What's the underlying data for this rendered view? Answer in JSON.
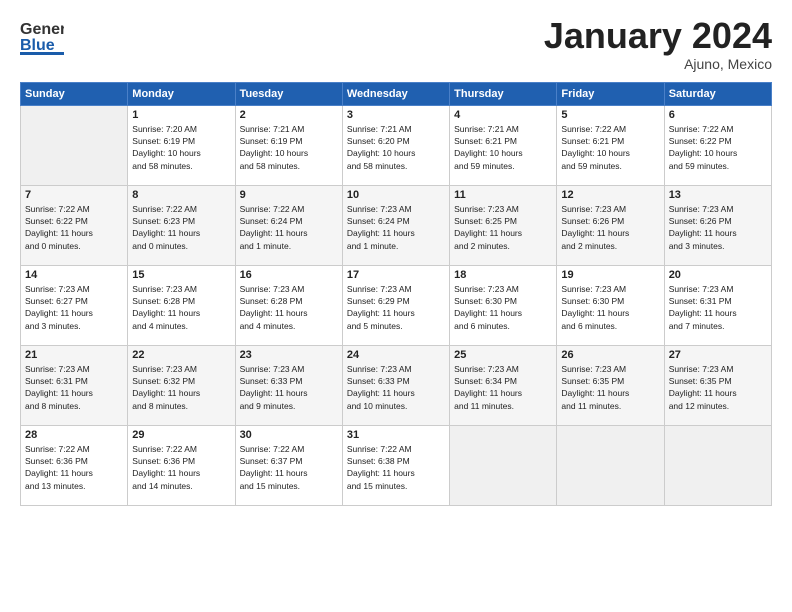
{
  "header": {
    "logo_general": "General",
    "logo_blue": "Blue",
    "month": "January 2024",
    "location": "Ajuno, Mexico"
  },
  "weekdays": [
    "Sunday",
    "Monday",
    "Tuesday",
    "Wednesday",
    "Thursday",
    "Friday",
    "Saturday"
  ],
  "weeks": [
    [
      {
        "day": "",
        "info": ""
      },
      {
        "day": "1",
        "info": "Sunrise: 7:20 AM\nSunset: 6:19 PM\nDaylight: 10 hours\nand 58 minutes."
      },
      {
        "day": "2",
        "info": "Sunrise: 7:21 AM\nSunset: 6:19 PM\nDaylight: 10 hours\nand 58 minutes."
      },
      {
        "day": "3",
        "info": "Sunrise: 7:21 AM\nSunset: 6:20 PM\nDaylight: 10 hours\nand 58 minutes."
      },
      {
        "day": "4",
        "info": "Sunrise: 7:21 AM\nSunset: 6:21 PM\nDaylight: 10 hours\nand 59 minutes."
      },
      {
        "day": "5",
        "info": "Sunrise: 7:22 AM\nSunset: 6:21 PM\nDaylight: 10 hours\nand 59 minutes."
      },
      {
        "day": "6",
        "info": "Sunrise: 7:22 AM\nSunset: 6:22 PM\nDaylight: 10 hours\nand 59 minutes."
      }
    ],
    [
      {
        "day": "7",
        "info": "Sunrise: 7:22 AM\nSunset: 6:22 PM\nDaylight: 11 hours\nand 0 minutes."
      },
      {
        "day": "8",
        "info": "Sunrise: 7:22 AM\nSunset: 6:23 PM\nDaylight: 11 hours\nand 0 minutes."
      },
      {
        "day": "9",
        "info": "Sunrise: 7:22 AM\nSunset: 6:24 PM\nDaylight: 11 hours\nand 1 minute."
      },
      {
        "day": "10",
        "info": "Sunrise: 7:23 AM\nSunset: 6:24 PM\nDaylight: 11 hours\nand 1 minute."
      },
      {
        "day": "11",
        "info": "Sunrise: 7:23 AM\nSunset: 6:25 PM\nDaylight: 11 hours\nand 2 minutes."
      },
      {
        "day": "12",
        "info": "Sunrise: 7:23 AM\nSunset: 6:26 PM\nDaylight: 11 hours\nand 2 minutes."
      },
      {
        "day": "13",
        "info": "Sunrise: 7:23 AM\nSunset: 6:26 PM\nDaylight: 11 hours\nand 3 minutes."
      }
    ],
    [
      {
        "day": "14",
        "info": "Sunrise: 7:23 AM\nSunset: 6:27 PM\nDaylight: 11 hours\nand 3 minutes."
      },
      {
        "day": "15",
        "info": "Sunrise: 7:23 AM\nSunset: 6:28 PM\nDaylight: 11 hours\nand 4 minutes."
      },
      {
        "day": "16",
        "info": "Sunrise: 7:23 AM\nSunset: 6:28 PM\nDaylight: 11 hours\nand 4 minutes."
      },
      {
        "day": "17",
        "info": "Sunrise: 7:23 AM\nSunset: 6:29 PM\nDaylight: 11 hours\nand 5 minutes."
      },
      {
        "day": "18",
        "info": "Sunrise: 7:23 AM\nSunset: 6:30 PM\nDaylight: 11 hours\nand 6 minutes."
      },
      {
        "day": "19",
        "info": "Sunrise: 7:23 AM\nSunset: 6:30 PM\nDaylight: 11 hours\nand 6 minutes."
      },
      {
        "day": "20",
        "info": "Sunrise: 7:23 AM\nSunset: 6:31 PM\nDaylight: 11 hours\nand 7 minutes."
      }
    ],
    [
      {
        "day": "21",
        "info": "Sunrise: 7:23 AM\nSunset: 6:31 PM\nDaylight: 11 hours\nand 8 minutes."
      },
      {
        "day": "22",
        "info": "Sunrise: 7:23 AM\nSunset: 6:32 PM\nDaylight: 11 hours\nand 8 minutes."
      },
      {
        "day": "23",
        "info": "Sunrise: 7:23 AM\nSunset: 6:33 PM\nDaylight: 11 hours\nand 9 minutes."
      },
      {
        "day": "24",
        "info": "Sunrise: 7:23 AM\nSunset: 6:33 PM\nDaylight: 11 hours\nand 10 minutes."
      },
      {
        "day": "25",
        "info": "Sunrise: 7:23 AM\nSunset: 6:34 PM\nDaylight: 11 hours\nand 11 minutes."
      },
      {
        "day": "26",
        "info": "Sunrise: 7:23 AM\nSunset: 6:35 PM\nDaylight: 11 hours\nand 11 minutes."
      },
      {
        "day": "27",
        "info": "Sunrise: 7:23 AM\nSunset: 6:35 PM\nDaylight: 11 hours\nand 12 minutes."
      }
    ],
    [
      {
        "day": "28",
        "info": "Sunrise: 7:22 AM\nSunset: 6:36 PM\nDaylight: 11 hours\nand 13 minutes."
      },
      {
        "day": "29",
        "info": "Sunrise: 7:22 AM\nSunset: 6:36 PM\nDaylight: 11 hours\nand 14 minutes."
      },
      {
        "day": "30",
        "info": "Sunrise: 7:22 AM\nSunset: 6:37 PM\nDaylight: 11 hours\nand 15 minutes."
      },
      {
        "day": "31",
        "info": "Sunrise: 7:22 AM\nSunset: 6:38 PM\nDaylight: 11 hours\nand 15 minutes."
      },
      {
        "day": "",
        "info": ""
      },
      {
        "day": "",
        "info": ""
      },
      {
        "day": "",
        "info": ""
      }
    ]
  ]
}
